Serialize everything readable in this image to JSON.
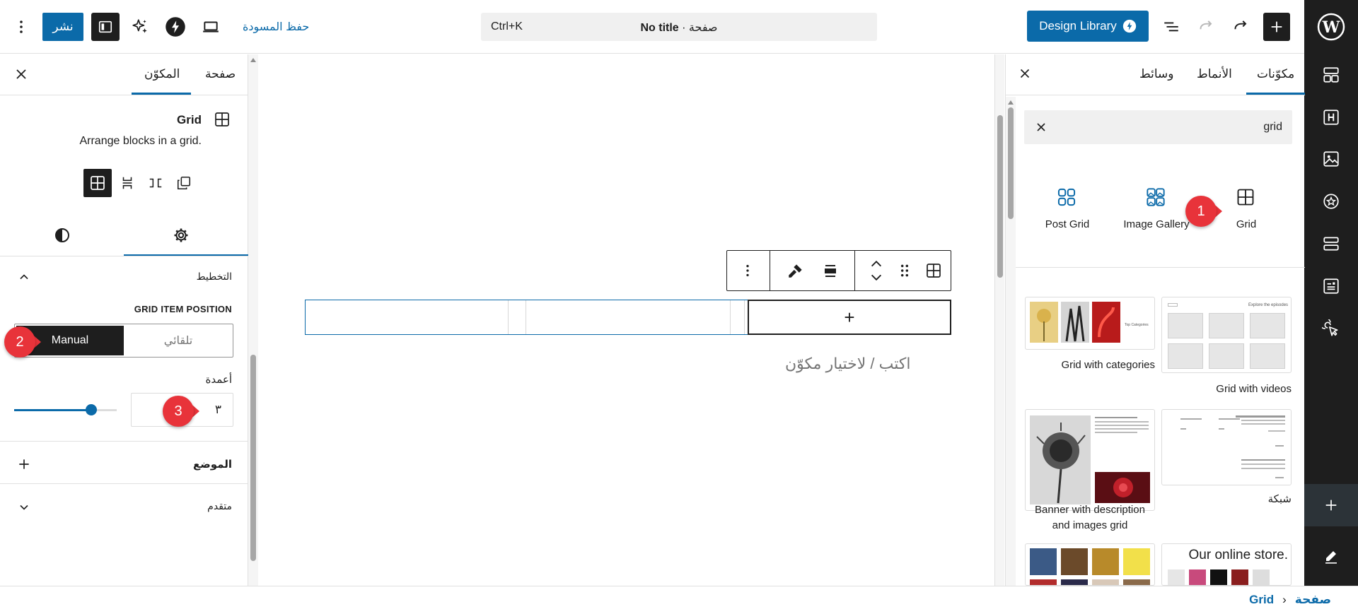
{
  "topbar": {
    "publish_label": "نشر",
    "save_draft_label": "حفظ المسودة",
    "command_shortcut": "Ctrl+K",
    "doc_title": "No title",
    "doc_type": " · صفحة",
    "design_library_label": "Design Library"
  },
  "left_panel": {
    "tabs": {
      "block": "المكوّن",
      "page": "صفحة"
    },
    "block_title": "Grid",
    "block_description": "Arrange blocks in a grid.",
    "layout_title": "التخطيط",
    "grid_item_position_label": "GRID ITEM POSITION",
    "segment_manual": "Manual",
    "segment_auto": "تلقائي",
    "columns_label": "أعمدة",
    "columns_value": "٣",
    "columns_slider_fraction": 0.75,
    "position_title": "الموضع",
    "advanced_title": "متقدم"
  },
  "canvas": {
    "placeholder": "اكتب / لاختيار مكوّن",
    "append_symbol": "+"
  },
  "inserter": {
    "tabs": {
      "blocks": "مكوّنات",
      "patterns": "الأنماط",
      "media": "وسائط"
    },
    "search_value": "grid",
    "blocks": [
      {
        "label": "Grid",
        "icon": "grid-icon"
      },
      {
        "label": "Image Gallery",
        "icon": "image-gallery-icon"
      },
      {
        "label": "Post Grid",
        "icon": "post-grid-icon"
      }
    ],
    "patterns": [
      {
        "label": "Grid with videos"
      },
      {
        "label": "Grid with categories"
      },
      {
        "label": "شبكة"
      },
      {
        "label": "Banner with description and images grid"
      }
    ],
    "pattern_texts": {
      "videos_header": "Explore the episodes",
      "categories_header": "Top Categories",
      "store_title": "Our online store."
    }
  },
  "breadcrumb": {
    "page": "صفحة",
    "separator": "›",
    "block": "Grid"
  },
  "annotations": [
    "1",
    "2",
    "3"
  ],
  "colors": {
    "accent": "#0b6aa9",
    "dark": "#1e1e1e",
    "badge": "#e8333a"
  }
}
